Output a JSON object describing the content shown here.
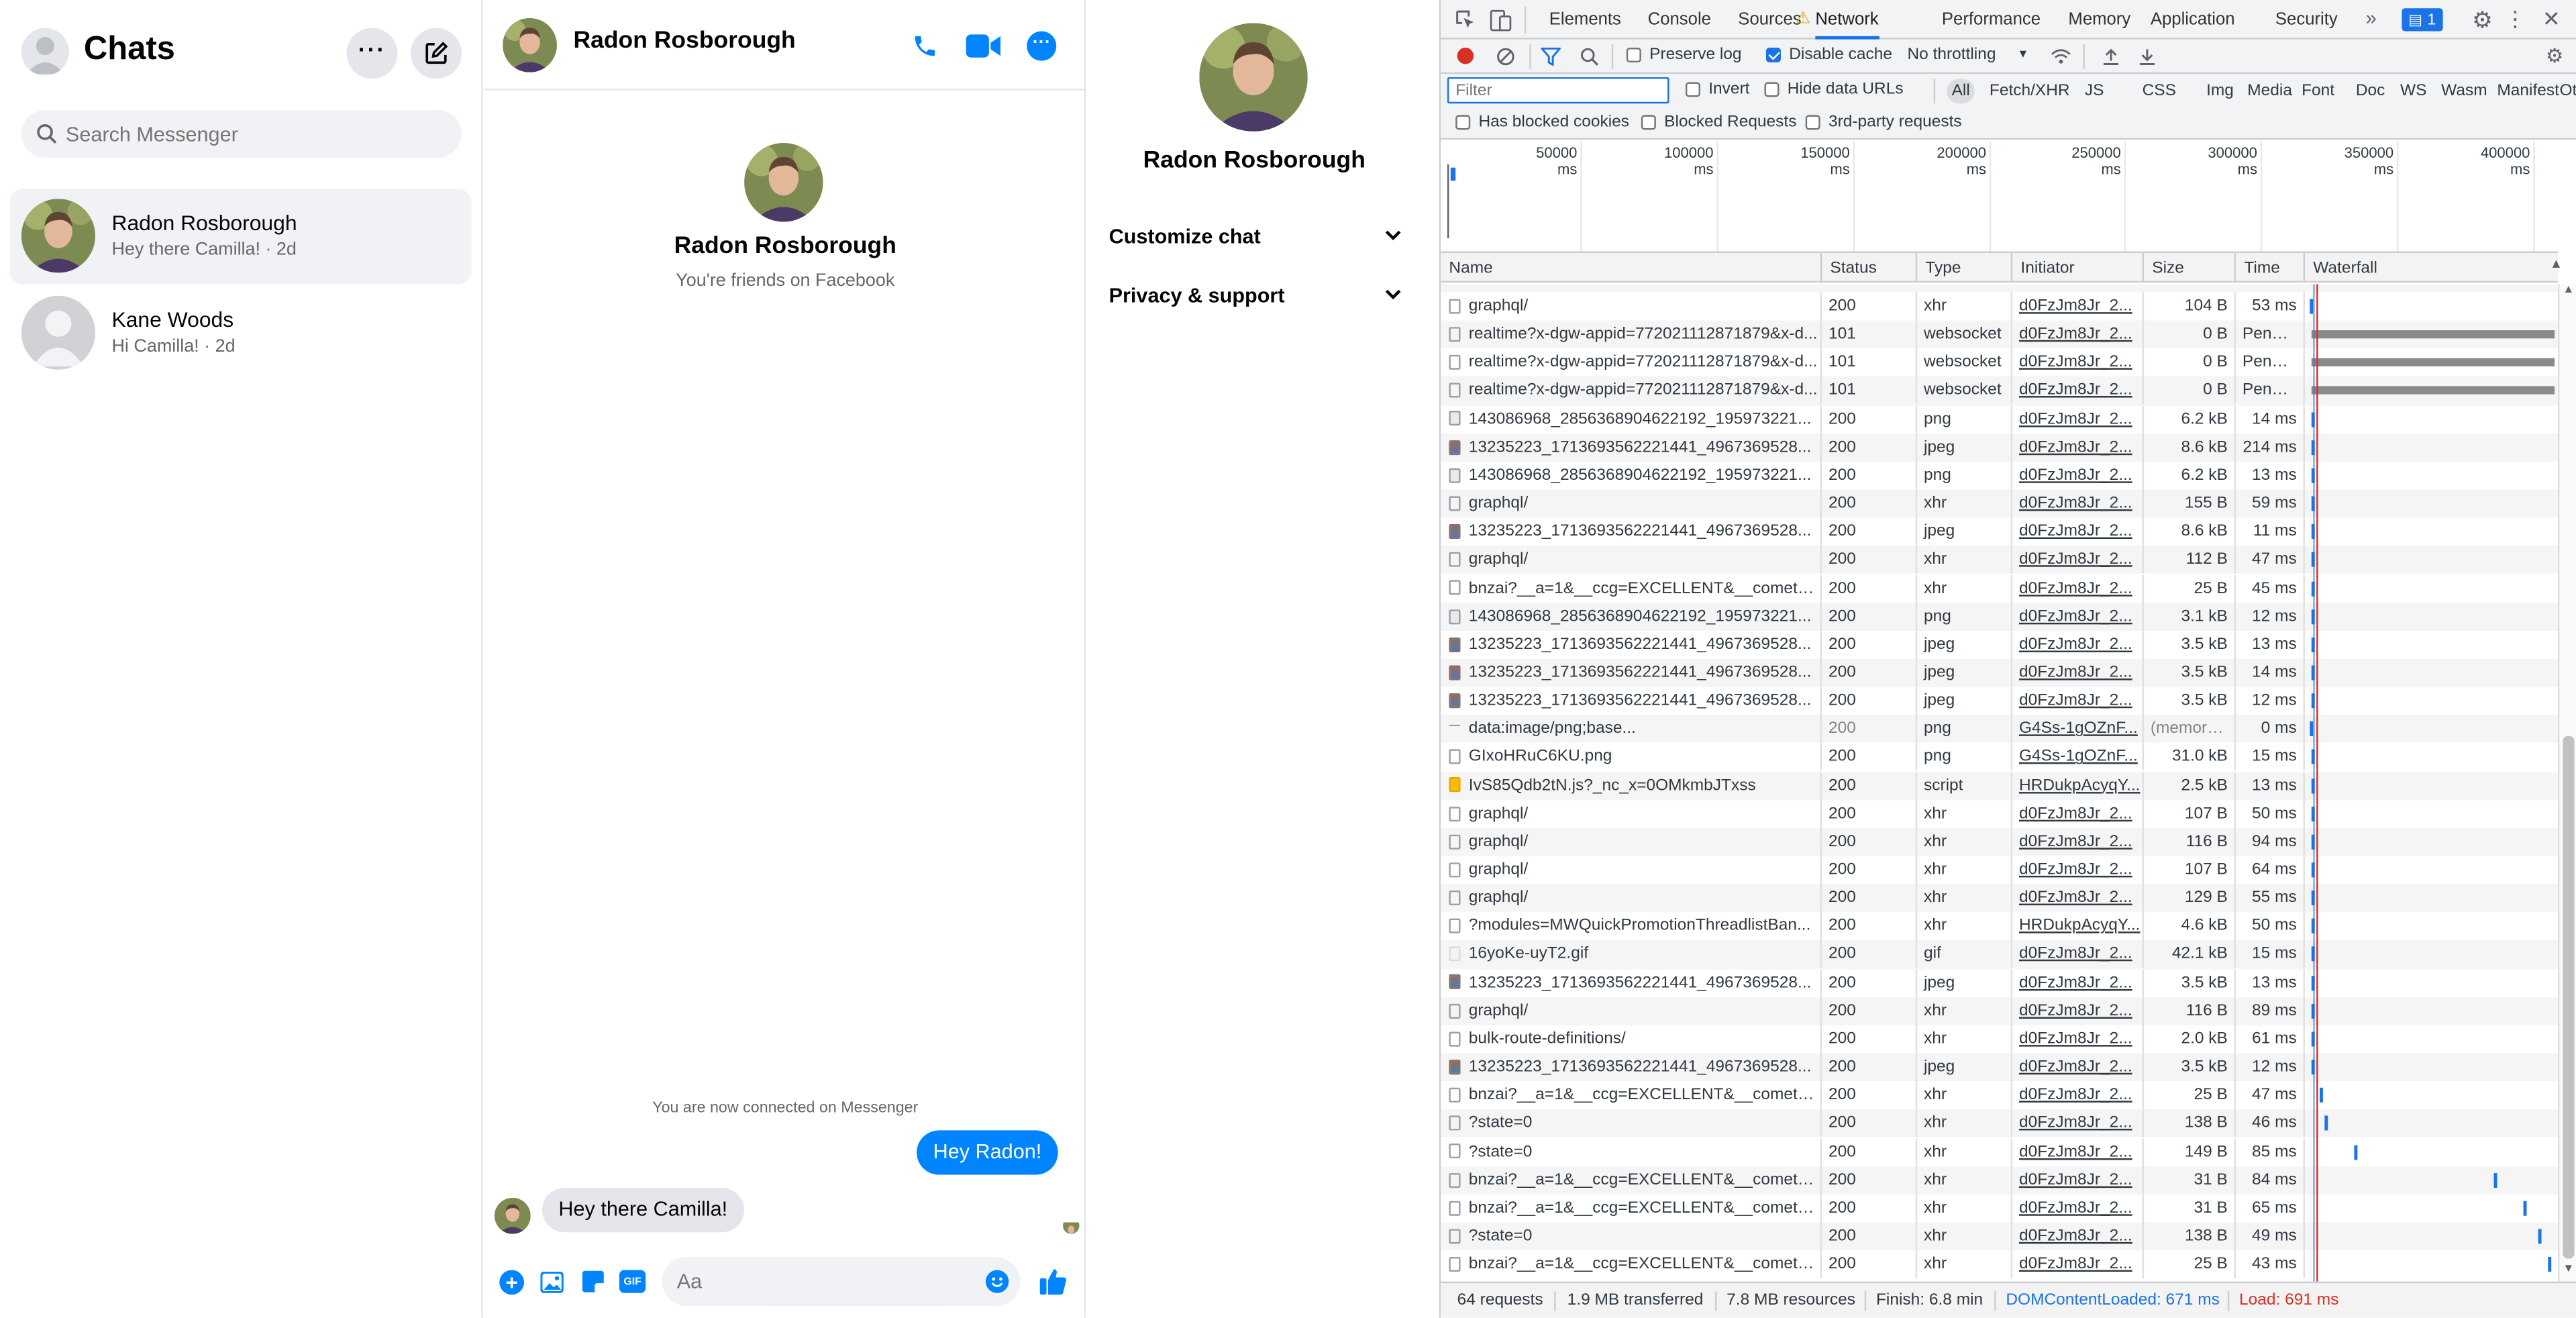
{
  "messenger": {
    "sidebar": {
      "title": "Chats",
      "search_placeholder": "Search Messenger",
      "chats": [
        {
          "name": "Radon Rosborough",
          "preview": "Hey there Camilla! · 2d",
          "selected": true
        },
        {
          "name": "Kane Woods",
          "preview": "Hi Camilla! · 2d",
          "selected": false
        }
      ]
    },
    "conversation": {
      "header_name": "Radon Rosborough",
      "profile_name": "Radon Rosborough",
      "profile_sub": "You're friends on Facebook",
      "system_message": "You are now connected on Messenger",
      "messages": [
        {
          "from": "me",
          "text": "Hey Radon!"
        },
        {
          "from": "them",
          "text": "Hey there Camilla!"
        }
      ],
      "composer_placeholder": "Aa"
    },
    "info_panel": {
      "name": "Radon Rosborough",
      "sections": [
        "Customize chat",
        "Privacy & support"
      ]
    },
    "colors": {
      "accent": "#0084ff",
      "bubble_in": "#e4e6eb",
      "muted": "#65676b"
    }
  },
  "devtools": {
    "tabs": [
      "Elements",
      "Console",
      "Sources",
      "Network",
      "Performance",
      "Memory",
      "Application",
      "Security"
    ],
    "active_tab": "Network",
    "issues_badge": "1",
    "toolbar": {
      "preserve_log": "Preserve log",
      "disable_cache": "Disable cache",
      "throttling": "No throttling"
    },
    "filter": {
      "placeholder": "Filter",
      "invert": "Invert",
      "hide_data_urls": "Hide data URLs",
      "types": [
        "All",
        "Fetch/XHR",
        "JS",
        "CSS",
        "Img",
        "Media",
        "Font",
        "Doc",
        "WS",
        "Wasm",
        "Manifest",
        "Other"
      ],
      "has_blocked_cookies": "Has blocked cookies",
      "blocked_requests": "Blocked Requests",
      "third_party": "3rd-party requests"
    },
    "timeline_ticks": [
      "50000 ms",
      "100000 ms",
      "150000 ms",
      "200000 ms",
      "250000 ms",
      "300000 ms",
      "350000 ms",
      "400000 ms"
    ],
    "columns": [
      "Name",
      "Status",
      "Type",
      "Initiator",
      "Size",
      "Time",
      "Waterfall"
    ],
    "rows": [
      {
        "name": "graphql/",
        "status": "200",
        "type": "xhr",
        "initiator": "d0FzJm8Jr_2...",
        "size": "104 B",
        "time": "53 ms",
        "icon": "doc"
      },
      {
        "name": "realtime?x-dgw-appid=772021112871879&x-d...",
        "status": "101",
        "type": "websocket",
        "initiator": "d0FzJm8Jr_2...",
        "size": "0 B",
        "time": "Pendi...",
        "icon": "doc"
      },
      {
        "name": "realtime?x-dgw-appid=772021112871879&x-d...",
        "status": "101",
        "type": "websocket",
        "initiator": "d0FzJm8Jr_2...",
        "size": "0 B",
        "time": "Pendi...",
        "icon": "doc"
      },
      {
        "name": "realtime?x-dgw-appid=772021112871879&x-d...",
        "status": "101",
        "type": "websocket",
        "initiator": "d0FzJm8Jr_2...",
        "size": "0 B",
        "time": "Pendi...",
        "icon": "doc"
      },
      {
        "name": "143086968_2856368904622192_195973221...",
        "status": "200",
        "type": "png",
        "initiator": "d0FzJm8Jr_2...",
        "size": "6.2 kB",
        "time": "14 ms",
        "icon": "img"
      },
      {
        "name": "13235223_1713693562221441_4967369528...",
        "status": "200",
        "type": "jpeg",
        "initiator": "d0FzJm8Jr_2...",
        "size": "8.6 kB",
        "time": "214 ms",
        "icon": "photo"
      },
      {
        "name": "143086968_2856368904622192_195973221...",
        "status": "200",
        "type": "png",
        "initiator": "d0FzJm8Jr_2...",
        "size": "6.2 kB",
        "time": "13 ms",
        "icon": "img"
      },
      {
        "name": "graphql/",
        "status": "200",
        "type": "xhr",
        "initiator": "d0FzJm8Jr_2...",
        "size": "155 B",
        "time": "59 ms",
        "icon": "doc"
      },
      {
        "name": "13235223_1713693562221441_4967369528...",
        "status": "200",
        "type": "jpeg",
        "initiator": "d0FzJm8Jr_2...",
        "size": "8.6 kB",
        "time": "11 ms",
        "icon": "photo"
      },
      {
        "name": "graphql/",
        "status": "200",
        "type": "xhr",
        "initiator": "d0FzJm8Jr_2...",
        "size": "112 B",
        "time": "47 ms",
        "icon": "doc"
      },
      {
        "name": "bnzai?__a=1&__ccg=EXCELLENT&__comet_re...",
        "status": "200",
        "type": "xhr",
        "initiator": "d0FzJm8Jr_2...",
        "size": "25 B",
        "time": "45 ms",
        "icon": "doc"
      },
      {
        "name": "143086968_2856368904622192_195973221...",
        "status": "200",
        "type": "png",
        "initiator": "d0FzJm8Jr_2...",
        "size": "3.1 kB",
        "time": "12 ms",
        "icon": "img"
      },
      {
        "name": "13235223_1713693562221441_4967369528...",
        "status": "200",
        "type": "jpeg",
        "initiator": "d0FzJm8Jr_2...",
        "size": "3.5 kB",
        "time": "13 ms",
        "icon": "photo"
      },
      {
        "name": "13235223_1713693562221441_4967369528...",
        "status": "200",
        "type": "jpeg",
        "initiator": "d0FzJm8Jr_2...",
        "size": "3.5 kB",
        "time": "14 ms",
        "icon": "photo"
      },
      {
        "name": "13235223_1713693562221441_4967369528...",
        "status": "200",
        "type": "jpeg",
        "initiator": "d0FzJm8Jr_2...",
        "size": "3.5 kB",
        "time": "12 ms",
        "icon": "photo"
      },
      {
        "name": "data:image/png;base...",
        "status": "200",
        "type": "png",
        "initiator": "G4Ss-1gOZnF...",
        "size": "(memory ...",
        "time": "0 ms",
        "icon": "data"
      },
      {
        "name": "GIxoHRuC6KU.png",
        "status": "200",
        "type": "png",
        "initiator": "G4Ss-1gOZnF...",
        "size": "31.0 kB",
        "time": "15 ms",
        "icon": "img2"
      },
      {
        "name": "IvS85Qdb2tN.js?_nc_x=0OMkmbJTxss",
        "status": "200",
        "type": "script",
        "initiator": "HRDukpAcyqY...",
        "size": "2.5 kB",
        "time": "13 ms",
        "icon": "script"
      },
      {
        "name": "graphql/",
        "status": "200",
        "type": "xhr",
        "initiator": "d0FzJm8Jr_2...",
        "size": "107 B",
        "time": "50 ms",
        "icon": "doc"
      },
      {
        "name": "graphql/",
        "status": "200",
        "type": "xhr",
        "initiator": "d0FzJm8Jr_2...",
        "size": "116 B",
        "time": "94 ms",
        "icon": "doc"
      },
      {
        "name": "graphql/",
        "status": "200",
        "type": "xhr",
        "initiator": "d0FzJm8Jr_2...",
        "size": "107 B",
        "time": "64 ms",
        "icon": "doc"
      },
      {
        "name": "graphql/",
        "status": "200",
        "type": "xhr",
        "initiator": "d0FzJm8Jr_2...",
        "size": "129 B",
        "time": "55 ms",
        "icon": "doc"
      },
      {
        "name": "?modules=MWQuickPromotionThreadlistBan...",
        "status": "200",
        "type": "xhr",
        "initiator": "HRDukpAcyqY...",
        "size": "4.6 kB",
        "time": "50 ms",
        "icon": "doc"
      },
      {
        "name": "16yoKe-uyT2.gif",
        "status": "200",
        "type": "gif",
        "initiator": "d0FzJm8Jr_2...",
        "size": "42.1 kB",
        "time": "15 ms",
        "icon": "gif"
      },
      {
        "name": "13235223_1713693562221441_4967369528...",
        "status": "200",
        "type": "jpeg",
        "initiator": "d0FzJm8Jr_2...",
        "size": "3.5 kB",
        "time": "13 ms",
        "icon": "photo"
      },
      {
        "name": "graphql/",
        "status": "200",
        "type": "xhr",
        "initiator": "d0FzJm8Jr_2...",
        "size": "116 B",
        "time": "89 ms",
        "icon": "doc"
      },
      {
        "name": "bulk-route-definitions/",
        "status": "200",
        "type": "xhr",
        "initiator": "d0FzJm8Jr_2...",
        "size": "2.0 kB",
        "time": "61 ms",
        "icon": "doc"
      },
      {
        "name": "13235223_1713693562221441_4967369528...",
        "status": "200",
        "type": "jpeg",
        "initiator": "d0FzJm8Jr_2...",
        "size": "3.5 kB",
        "time": "12 ms",
        "icon": "photo"
      },
      {
        "name": "bnzai?__a=1&__ccg=EXCELLENT&__comet_re...",
        "status": "200",
        "type": "xhr",
        "initiator": "d0FzJm8Jr_2...",
        "size": "25 B",
        "time": "47 ms",
        "icon": "doc"
      },
      {
        "name": "?state=0",
        "status": "200",
        "type": "xhr",
        "initiator": "d0FzJm8Jr_2...",
        "size": "138 B",
        "time": "46 ms",
        "icon": "doc"
      },
      {
        "name": "?state=0",
        "status": "200",
        "type": "xhr",
        "initiator": "d0FzJm8Jr_2...",
        "size": "149 B",
        "time": "85 ms",
        "icon": "doc"
      },
      {
        "name": "bnzai?__a=1&__ccg=EXCELLENT&__comet_re...",
        "status": "200",
        "type": "xhr",
        "initiator": "d0FzJm8Jr_2...",
        "size": "31 B",
        "time": "84 ms",
        "icon": "doc"
      },
      {
        "name": "bnzai?__a=1&__ccg=EXCELLENT&__comet_re...",
        "status": "200",
        "type": "xhr",
        "initiator": "d0FzJm8Jr_2...",
        "size": "31 B",
        "time": "65 ms",
        "icon": "doc"
      },
      {
        "name": "?state=0",
        "status": "200",
        "type": "xhr",
        "initiator": "d0FzJm8Jr_2...",
        "size": "138 B",
        "time": "49 ms",
        "icon": "doc"
      },
      {
        "name": "bnzai?__a=1&__ccg=EXCELLENT&__comet_re...",
        "status": "200",
        "type": "xhr",
        "initiator": "d0FzJm8Jr_2...",
        "size": "25 B",
        "time": "43 ms",
        "icon": "doc"
      }
    ],
    "summary": {
      "requests": "64 requests",
      "transferred": "1.9 MB transferred",
      "resources": "7.8 MB resources",
      "finish": "Finish: 6.8 min",
      "dcl": "DOMContentLoaded: 671 ms",
      "load": "Load: 691 ms"
    }
  }
}
